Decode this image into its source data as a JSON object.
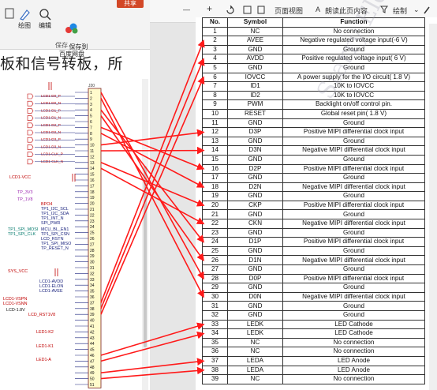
{
  "left_window": {
    "ribbon": {
      "share_label": "共享",
      "draw_label": "绘图",
      "edit_label": "编辑",
      "search_label": "搜",
      "save_to_cloud_label": "保存到\n百度网盘",
      "save_group_label": "保存"
    },
    "document_text": "板和信号转板，所",
    "schematic": {
      "connector_label": "J20",
      "connector_ref": "FT_RES515",
      "pin_numbers": [
        "1",
        "2",
        "3",
        "4",
        "5",
        "6",
        "7",
        "8",
        "9",
        "10",
        "11",
        "12",
        "13",
        "14",
        "15",
        "16",
        "17",
        "18",
        "19",
        "20",
        "21",
        "22",
        "23",
        "24",
        "25",
        "26",
        "27",
        "28",
        "29",
        "30",
        "31",
        "32",
        "33",
        "34",
        "35",
        "36",
        "37",
        "38",
        "39",
        "40",
        "41",
        "42",
        "43",
        "44",
        "45",
        "46",
        "47",
        "48",
        "49",
        "50",
        "51"
      ],
      "net_labels_left": [
        {
          "text": "LCD1-D0_P",
          "color": "#c00000"
        },
        {
          "text": "LCD1-D0_N",
          "color": "#c00000"
        },
        {
          "text": "LCD1-D1_P",
          "color": "#c00000"
        },
        {
          "text": "LCD1-D1_N",
          "color": "#c00000"
        },
        {
          "text": "LCD1-D2_P",
          "color": "#c00000"
        },
        {
          "text": "LCD1-D2_N",
          "color": "#c00000"
        },
        {
          "text": "LCD1-D3_P",
          "color": "#c00000"
        },
        {
          "text": "LCD1-D3_N",
          "color": "#c00000"
        },
        {
          "text": "LCD1-CLK_P",
          "color": "#c00000"
        },
        {
          "text": "LCD1-CLK_N",
          "color": "#c00000"
        }
      ],
      "signal_labels": [
        {
          "text": "LCD1-VCC",
          "color": "#c00000"
        },
        {
          "text": "TP_3V3",
          "color": "#9c27b0"
        },
        {
          "text": "TP_1V8",
          "color": "#9c27b0"
        },
        {
          "text": "BPO4",
          "color": "#c00000"
        },
        {
          "text": "TP1_I2C_SCL",
          "color": "#1a237e"
        },
        {
          "text": "TP1_I2C_SDA",
          "color": "#1a237e"
        },
        {
          "text": "TP1_INT_N",
          "color": "#1a237e"
        },
        {
          "text": "SPI_PWR",
          "color": "#1a237e"
        },
        {
          "text": "TP1_SPI_MOSI",
          "color": "#00796b"
        },
        {
          "text": "TP1_SPI_CLK",
          "color": "#00796b"
        },
        {
          "text": "MCU_BL_EN1",
          "color": "#1a237e"
        },
        {
          "text": "TP1_SPI_CSN",
          "color": "#1a237e"
        },
        {
          "text": "LCD_RSTN",
          "color": "#1a237e"
        },
        {
          "text": "TP1_SPI_MISO",
          "color": "#1a237e"
        },
        {
          "text": "TP_RESET_N",
          "color": "#1a237e"
        },
        {
          "text": "SYS_VCC",
          "color": "#c00000"
        },
        {
          "text": "LCD1-AVDD",
          "color": "#1a237e"
        },
        {
          "text": "LCD1-ELON",
          "color": "#1a237e"
        },
        {
          "text": "LCD1-AVEE",
          "color": "#1a237e"
        },
        {
          "text": "LCD1-VSPN",
          "color": "#c00000"
        },
        {
          "text": "LCD1-VSNN",
          "color": "#c00000"
        },
        {
          "text": "LCD-1.8V",
          "color": "#111111"
        },
        {
          "text": "LCD_RST1V8",
          "color": "#c00000"
        },
        {
          "text": "LED1-K2",
          "color": "#c00000"
        },
        {
          "text": "LED1-K1",
          "color": "#c00000"
        },
        {
          "text": "LED1-A",
          "color": "#c00000"
        }
      ]
    }
  },
  "pdf_viewer": {
    "toolbar": {
      "minus": "—",
      "plus": "+",
      "page_view_label": "页面视图",
      "read_label": "朗读此页内容",
      "draw_label": "绘制"
    },
    "watermark_text": "Starry Electronic Technology",
    "table": {
      "headers": [
        "No.",
        "Symbol",
        "Function"
      ],
      "rows": [
        [
          "1",
          "NC",
          "No connection"
        ],
        [
          "2",
          "AVEE",
          "Negative regulated voltage input(-6 V)"
        ],
        [
          "3",
          "GND",
          "Ground"
        ],
        [
          "4",
          "AVDD",
          "Positive regulated voltage input( 6 V)"
        ],
        [
          "5",
          "GND",
          "Ground"
        ],
        [
          "6",
          "IOVCC",
          "A power supply for the I/O circuit( 1.8 V)"
        ],
        [
          "7",
          "ID1",
          "10K to IOVCC"
        ],
        [
          "8",
          "ID2",
          "10K to IOVCC"
        ],
        [
          "9",
          "PWM",
          "Backlight on/off control pin."
        ],
        [
          "10",
          "RESET",
          "Global reset pin( 1.8 V)"
        ],
        [
          "11",
          "GND",
          "Ground"
        ],
        [
          "12",
          "D3P",
          "Positive MIPI differential clock input"
        ],
        [
          "13",
          "GND",
          "Ground"
        ],
        [
          "14",
          "D3N",
          "Negative MIPI differential clock input"
        ],
        [
          "15",
          "GND",
          "Ground"
        ],
        [
          "16",
          "D2P",
          "Positive MIPI differential clock input"
        ],
        [
          "17",
          "GND",
          "Ground"
        ],
        [
          "18",
          "D2N",
          "Negative MIPI differential clock input"
        ],
        [
          "19",
          "GND",
          "Ground"
        ],
        [
          "20",
          "CKP",
          "Positive MIPI differential clock input"
        ],
        [
          "21",
          "GND",
          "Ground"
        ],
        [
          "22",
          "CKN",
          "Negative MIPI differential clock input"
        ],
        [
          "23",
          "GND",
          "Ground"
        ],
        [
          "24",
          "D1P",
          "Positive MIPI differential clock input"
        ],
        [
          "25",
          "GND",
          "Ground"
        ],
        [
          "26",
          "D1N",
          "Negative MIPI differential clock input"
        ],
        [
          "27",
          "GND",
          "Ground"
        ],
        [
          "28",
          "D0P",
          "Positive MIPI differential clock input"
        ],
        [
          "29",
          "GND",
          "Ground"
        ],
        [
          "30",
          "D0N",
          "Negative MIPI differential clock input"
        ],
        [
          "31",
          "GND",
          "Ground"
        ],
        [
          "32",
          "GND",
          "Ground"
        ],
        [
          "33",
          "LEDK",
          "LED Cathode"
        ],
        [
          "34",
          "LEDK",
          "LED Cathode"
        ],
        [
          "35",
          "NC",
          "No connection"
        ],
        [
          "36",
          "NC",
          "No connection"
        ],
        [
          "37",
          "LEDA",
          "LED Anode"
        ],
        [
          "38",
          "LEDA",
          "LED Anode"
        ],
        [
          "39",
          "NC",
          "No connection"
        ]
      ]
    }
  },
  "annotation": {
    "arrow_color": "#ff1a1a",
    "connections": [
      {
        "from_pin": 1,
        "to_row": 28
      },
      {
        "from_pin": 2,
        "to_row": 30
      },
      {
        "from_pin": 4,
        "to_row": 24
      },
      {
        "from_pin": 5,
        "to_row": 26
      },
      {
        "from_pin": 7,
        "to_row": 16
      },
      {
        "from_pin": 8,
        "to_row": 18
      },
      {
        "from_pin": 10,
        "to_row": 12
      },
      {
        "from_pin": 11,
        "to_row": 14
      },
      {
        "from_pin": 13,
        "to_row": 20
      },
      {
        "from_pin": 14,
        "to_row": 22
      },
      {
        "from_pin": 37,
        "to_row": 2
      },
      {
        "from_pin": 38,
        "to_row": 4
      },
      {
        "from_pin": 39,
        "to_row": 6
      },
      {
        "from_pin": 46,
        "to_row": 33
      },
      {
        "from_pin": 47,
        "to_row": 34
      },
      {
        "from_pin": 49,
        "to_row": 37
      },
      {
        "from_pin": 50,
        "to_row": 38
      }
    ]
  }
}
